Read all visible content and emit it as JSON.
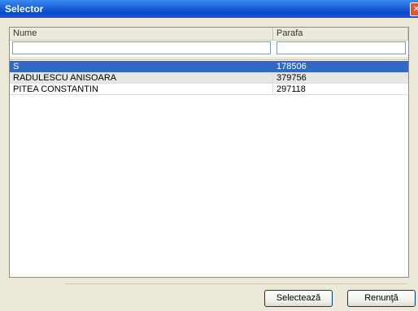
{
  "window": {
    "title": "Selector",
    "close_glyph": "✕"
  },
  "grid": {
    "columns": [
      "Nume",
      "Parafa"
    ],
    "filter": {
      "name_value": "",
      "parafa_value": ""
    },
    "rows": [
      {
        "name": "S",
        "parafa": "178506",
        "selected": true
      },
      {
        "name": "RADULESCU ANISOARA",
        "parafa": "379756",
        "selected": false
      },
      {
        "name": "PITEA CONSTANTIN",
        "parafa": "297118",
        "selected": false
      }
    ]
  },
  "status": {
    "text": ""
  },
  "buttons": {
    "select_label": "Selectează",
    "cancel_label": "Renunţă"
  },
  "colors": {
    "title_bar": "#1c5fd8",
    "selection": "#316ac5",
    "face": "#ece9d8"
  }
}
